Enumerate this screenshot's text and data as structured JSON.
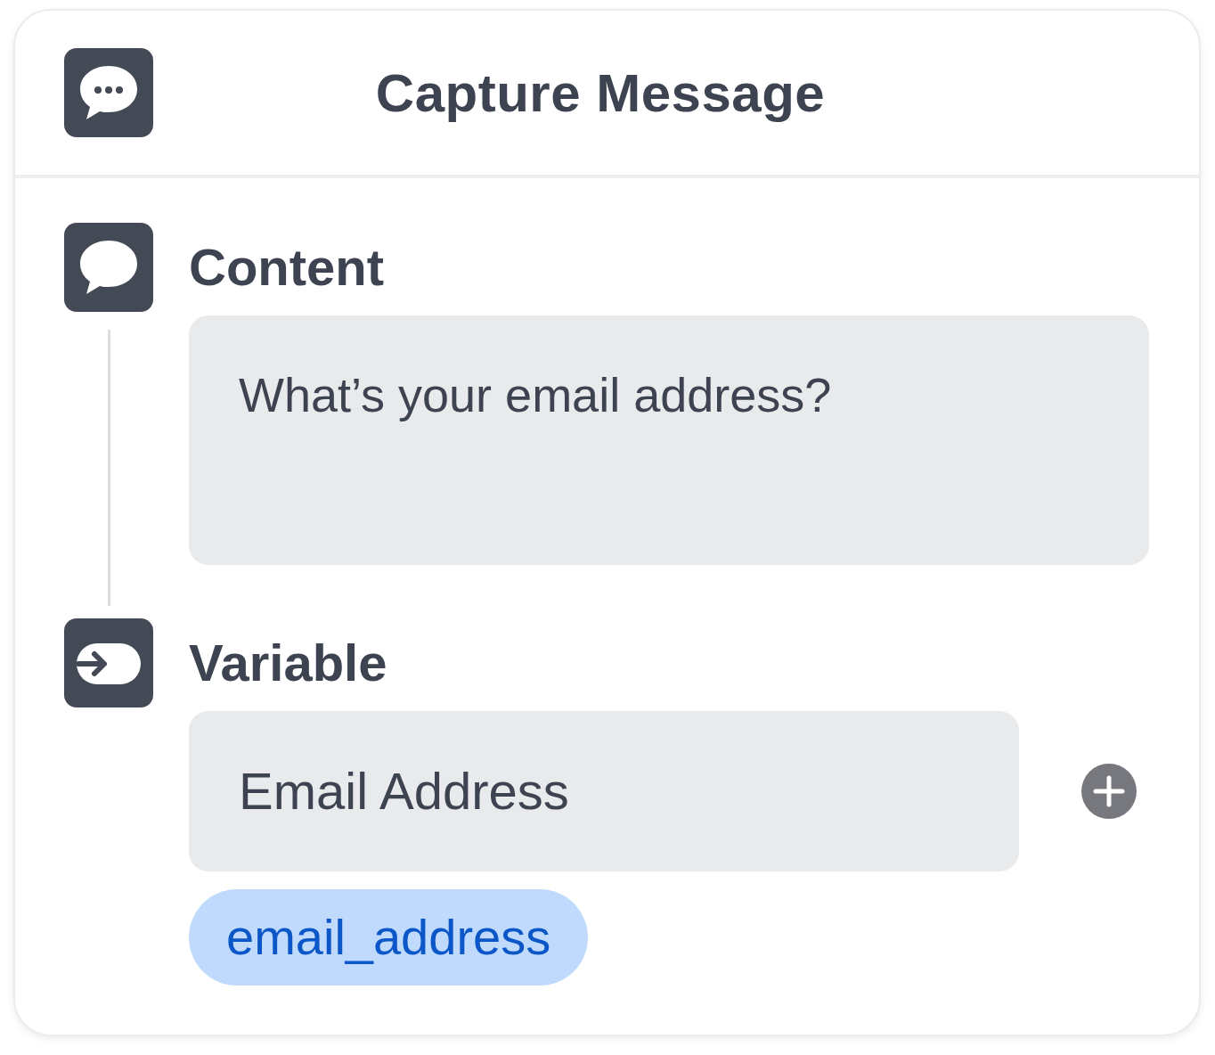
{
  "header": {
    "title": "Capture Message"
  },
  "sections": [
    {
      "kind": "text",
      "label": "Content",
      "value": "What’s your email address?"
    },
    {
      "kind": "variable",
      "label": "Variable",
      "value": "Email Address",
      "tag": "email_address"
    }
  ]
}
